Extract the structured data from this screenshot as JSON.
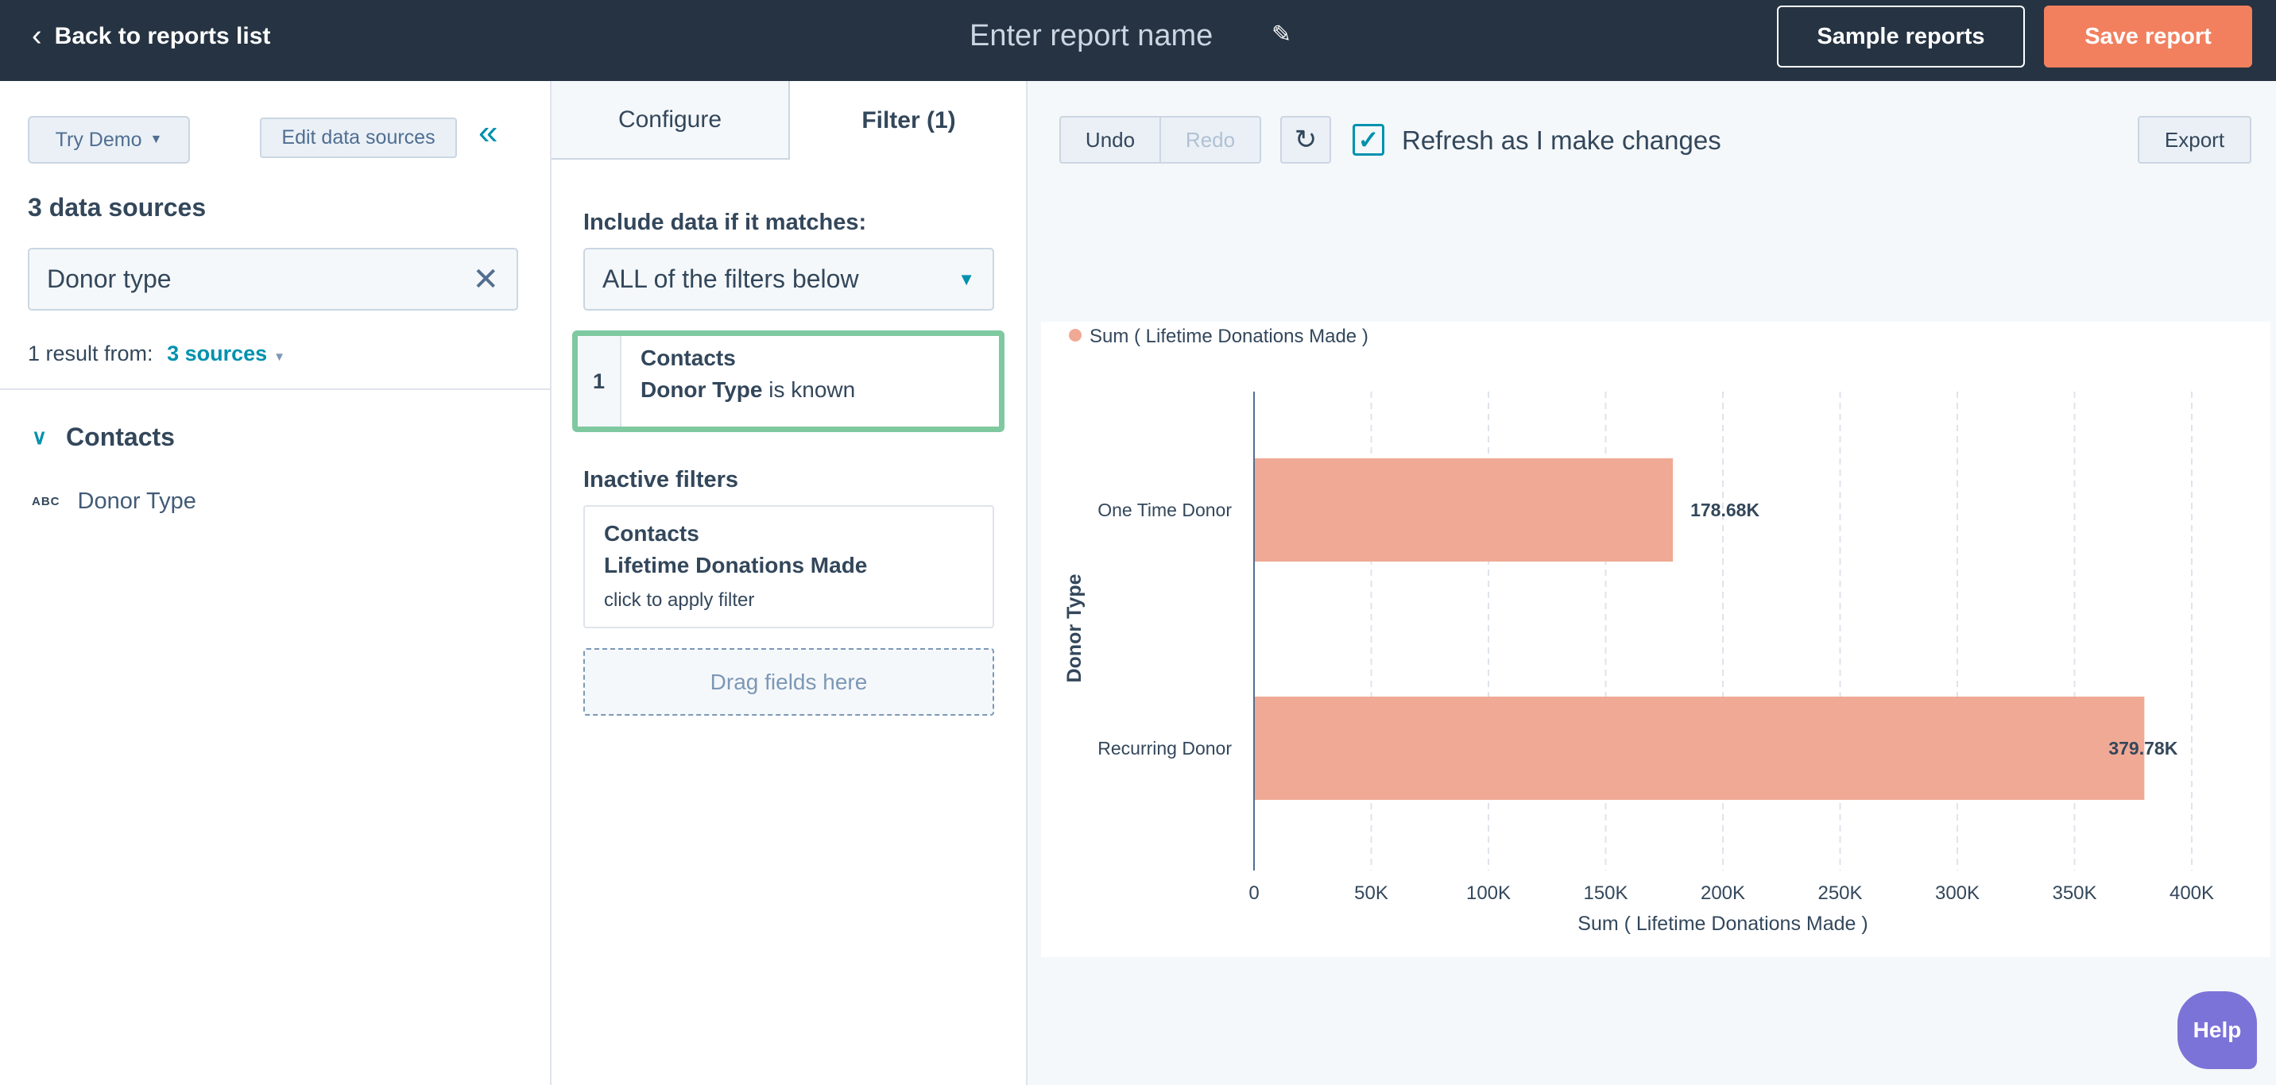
{
  "header": {
    "back_label": "Back to reports list",
    "report_name_placeholder": "Enter report name",
    "sample_reports": "Sample reports",
    "save_report": "Save report"
  },
  "left": {
    "try_demo": "Try Demo",
    "edit_sources": "Edit data sources",
    "sources_title": "3 data sources",
    "search_value": "Donor type",
    "result_prefix": "1 result from:",
    "result_sources": "3 sources",
    "group": "Contacts",
    "field_type": "ABC",
    "field": "Donor Type"
  },
  "middle": {
    "tabs": [
      {
        "label": "Configure"
      },
      {
        "label": "Filter (1)"
      }
    ],
    "include_label": "Include data if it matches:",
    "match_select": "ALL of the filters below",
    "active_filter": {
      "number": "1",
      "object": "Contacts",
      "property": "Donor Type",
      "operator": "is known"
    },
    "inactive_label": "Inactive filters",
    "inactive_filter": {
      "object": "Contacts",
      "property": "Lifetime Donations Made",
      "hint": "click to apply filter"
    },
    "drag_label": "Drag fields here"
  },
  "toolbar": {
    "undo": "Undo",
    "redo": "Redo",
    "refresh_label": "Refresh as I make changes",
    "refresh_checked": true,
    "export": "Export"
  },
  "help": "Help",
  "colors": {
    "bar": "#f0a994",
    "accent": "#f2805f",
    "header": "#253342",
    "filter_border": "#7fc9a0",
    "help": "#7c73d8"
  },
  "chart_data": {
    "type": "bar",
    "orientation": "horizontal",
    "categories": [
      "One Time Donor",
      "Recurring Donor"
    ],
    "series": [
      {
        "name": "Sum ( Lifetime Donations Made )",
        "values": [
          178680,
          379780
        ]
      }
    ],
    "data_labels": [
      "178.68K",
      "379.78K"
    ],
    "xlabel": "Sum ( Lifetime Donations Made )",
    "ylabel": "Donor Type",
    "xlim": [
      0,
      400000
    ],
    "xticks": [
      "0",
      "50K",
      "100K",
      "150K",
      "200K",
      "250K",
      "300K",
      "350K",
      "400K"
    ],
    "grid": true,
    "legend": "top-left"
  }
}
